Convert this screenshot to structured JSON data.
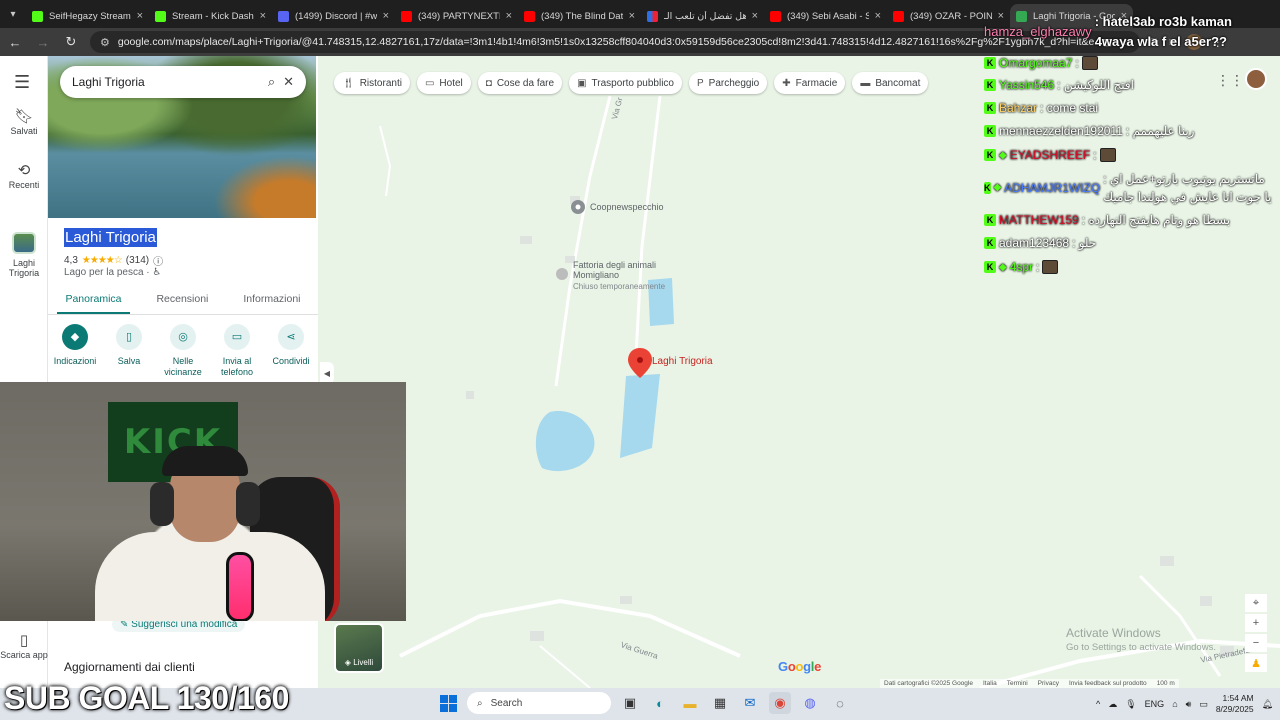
{
  "browser": {
    "tabs": [
      {
        "title": "SeifHegazy Stream -",
        "favicon": "kick-icon",
        "active": false
      },
      {
        "title": "Stream - Kick Dashbo",
        "favicon": "kick-icon",
        "active": false
      },
      {
        "title": "(1499) Discord | #wel",
        "favicon": "discord-icon",
        "active": false
      },
      {
        "title": "(349) PARTYNEXTDO",
        "favicon": "youtube-icon",
        "active": false
      },
      {
        "title": "(349) The Blind Date",
        "favicon": "youtube-icon",
        "active": false
      },
      {
        "title": "هل تفضل أن تلعب الـ",
        "favicon": "flag-icon",
        "active": false
      },
      {
        "title": "(349) Sebi Asabi - Se",
        "favicon": "youtube-icon",
        "active": false
      },
      {
        "title": "(349) OZAR - POINT",
        "favicon": "youtube-icon",
        "active": false
      },
      {
        "title": "Laghi Trigoria - Goo",
        "favicon": "maps-icon",
        "active": true
      }
    ],
    "url": "google.com/maps/place/Laghi+Trigoria/@41.748315,12.4827161,17z/data=!3m1!4b1!4m6!3m5!1s0x13258cff804040d3:0x59159d56ce2305cd!8m2!3d41.748315!4d12.4827161!16s%2Fg%2F1ygbh7k_d?hl=it&entry=ttu"
  },
  "rail": {
    "items": [
      {
        "label": "Salvati",
        "icon": "bookmark-icon"
      },
      {
        "label": "Recenti",
        "icon": "history-icon"
      },
      {
        "label": "Laghi Trigoria",
        "icon": "place-thumb"
      }
    ],
    "download": "Scarica app"
  },
  "place": {
    "search_value": "Laghi Trigoria",
    "title": "Laghi Trigoria",
    "rating": "4,3",
    "reviews": "(314)",
    "type": "Lago per la pesca",
    "tabs": [
      "Panoramica",
      "Recensioni",
      "Informazioni"
    ],
    "actions": [
      {
        "label": "Indicazioni",
        "icon": "directions-icon"
      },
      {
        "label": "Salva",
        "icon": "bookmark-icon"
      },
      {
        "label": "Nelle vicinanze",
        "icon": "nearby-icon"
      },
      {
        "label": "Invia al telefono",
        "icon": "phone-icon"
      },
      {
        "label": "Condividi",
        "icon": "share-icon"
      }
    ],
    "suggest": "Suggerisci una modifica",
    "updates": "Aggiornamenti dai clienti"
  },
  "map": {
    "chips": [
      {
        "label": "Ristoranti",
        "icon": "restaurant-icon"
      },
      {
        "label": "Hotel",
        "icon": "hotel-icon"
      },
      {
        "label": "Cose da fare",
        "icon": "camera-icon"
      },
      {
        "label": "Trasporto pubblico",
        "icon": "transit-icon"
      },
      {
        "label": "Parcheggio",
        "icon": "parking-icon"
      },
      {
        "label": "Farmacie",
        "icon": "pharmacy-icon"
      },
      {
        "label": "Bancomat",
        "icon": "atm-icon"
      }
    ],
    "labels": {
      "coop": "Coopnewspecchio",
      "fattoria": "Fattoria degli animali Momigliano",
      "fattoria_status": "Chiuso temporaneamente",
      "pin": "Laghi Trigoria",
      "via_gr": "Via Gr",
      "via_pietradefusi": "Via Pietradefusi",
      "via_guerra": "Via Guerra"
    },
    "layers": "Livelli",
    "google": "Google",
    "footer": [
      "Dati cartografici ©2025 Google",
      "Italia",
      "Termini",
      "Privacy",
      "Invia feedback sul prodotto",
      "100 m"
    ],
    "activate_title": "Activate Windows",
    "activate_sub": "Go to Settings to activate Windows."
  },
  "chat": [
    {
      "user": "hamza_elghazawy",
      "text": ": hatel3ab ro3b kaman 4waya wla f el a5er??",
      "color": "#ff7fb0",
      "badges": false
    },
    {
      "user": "Omargomaa7",
      "text": ":",
      "color": "#53fc18",
      "badges": true
    },
    {
      "user": "Yassin546",
      "text": ": افتح اللوكيشن",
      "color": "#53fc18",
      "badges": true
    },
    {
      "user": "Bahzar",
      "text": ": come stai",
      "color": "#ffd36b",
      "badges": true
    },
    {
      "user": "mennaezzelden192011",
      "text": ": ربنا عليهممم",
      "color": "#ffffff",
      "badges": true
    },
    {
      "user": "EYADSHREEF",
      "text": ":",
      "color": "#d0122a",
      "badges": true
    },
    {
      "user": "ADHAMJR1WIZQ",
      "text": ": ماتستريم يوتيوب بارتو+عمل اي يا جوت انا عايش في هولندا جاميك",
      "color": "#4a7bff",
      "badges": true
    },
    {
      "user": "MATTHEW159",
      "text": ": بسطا هو وتام هايفتح النهارده",
      "color": "#d0122a",
      "badges": true
    },
    {
      "user": "adam123468",
      "text": ": حلو",
      "color": "#ffffff",
      "badges": true
    },
    {
      "user": "4spr",
      "text": ":",
      "color": "#53fc18",
      "badges": true
    }
  ],
  "overlay": {
    "subgoal": "SUB GOAL 130/160"
  },
  "taskbar": {
    "search": "Search",
    "lang": "ENG",
    "time": "1:54 AM",
    "date": "8/29/2025"
  }
}
